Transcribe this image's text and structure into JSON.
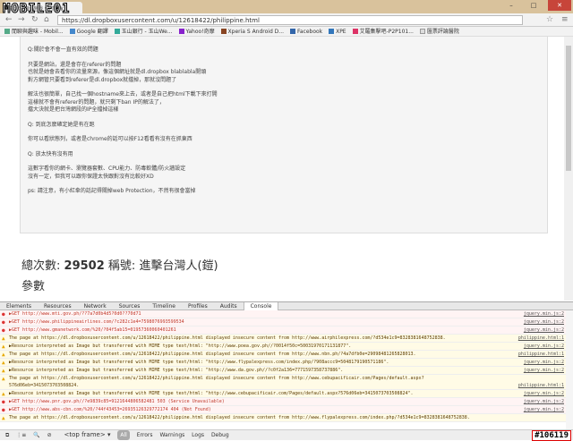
{
  "browser": {
    "tab_title": "自然閃斷 遊戲 STTATK",
    "logo": "MOBILE01",
    "url": "https://dl.dropboxusercontent.com/u/12618422/philippine.html",
    "bookmarks": [
      "閒聊與趣味 - Mobil...",
      "Google 翻譯",
      "玉山銀行 - 玉山We...",
      "Yahoo!奇摩",
      "Xperia S Android D...",
      "Facebook",
      "XPE",
      "艾羅集擊吧-P2P101...",
      "匯票評論醫院"
    ]
  },
  "article": {
    "paragraphs": [
      [
        "Q:關於會不會一直有效的問題"
      ],
      [
        "只要是網站，還是會存在referer的問題",
        "也就是她會去看你的流量來源，像這個網址就是dl.dropbox blablabla開頭",
        "對方網管只要看到referer是dl.dropbox就擋掉，那就沒問題了"
      ],
      [
        "解法也很簡單，自己找一個hostname來上去，或者是自己把html下載下來打開",
        "這樣就不會有referer的問題，就只剩下ban IP的解法了，",
        "擋大決就是把台灣網段的IP全擋掉這樣"
      ],
      [
        "Q: 到底怎麼確定她是有在跑"
      ],
      [
        "你可以看狀態列，或者是chrome的話可以按F12看看有沒有在抓東西"
      ],
      [
        "Q: 放太快有沒有用"
      ],
      [
        "這數字看你的網卡、瀏覽器套數、CPU能力、防毒軟體/防火牆設定",
        "沒有一定，但我可以跟你保證太快跟對沒有比較好XD"
      ],
      [
        "ps: 請注意，有小紅傘的話記得關掉web Protection，不然有很會當掉"
      ]
    ]
  },
  "stats": {
    "label_count": "總次數:",
    "count": "29502",
    "label_title": "稱號:",
    "title": "進擊台灣人(鎧)"
  },
  "params_heading": "參數",
  "devtools": {
    "tabs": [
      "Elements",
      "Resources",
      "Network",
      "Sources",
      "Timeline",
      "Profiles",
      "Audits",
      "Console"
    ],
    "active": "Console",
    "logs": [
      {
        "type": "err",
        "text": "▶GET http://www.mti.gov.ph/??7a7d0b4d5?0d0??70d71",
        "src": "jquery.min.js:2"
      },
      {
        "type": "err",
        "text": "▶GET http://www.philippineairlines.com/?c282c1e4=7598076993599534",
        "src": "jquery.min.js:2"
      },
      {
        "type": "err",
        "text": "▶GET http://www.gmanetwork.com/%20/?04f5ab15=01957360060401261",
        "src": "jquery.min.js:2"
      },
      {
        "type": "warn",
        "text": "The page at https://dl.dropboxusercontent.com/u/12618422/philippine.html displayed insecure content from http://www.airphilexpress.com/?d534e1c9=8328381648752838.",
        "src": "philippine.html:1"
      },
      {
        "type": "warn",
        "text": "▶Resource interpreted as Image but transferred with MIME type text/html: \"http://www.poea.gov.ph//?0014f50c=50031970171131877\".",
        "src": "jquery.min.js:2"
      },
      {
        "type": "warn",
        "text": "The page at https://dl.dropboxusercontent.com/u/12618422/philippine.html displayed insecure content from http://www.nbn.ph/?4a7dfb0e=29098481265828013.",
        "src": "philippine.html:1"
      },
      {
        "type": "warn",
        "text": "▶Resource interpreted as Image but transferred with MIME type text/html: \"http://www.flypalexpress.com/index.php/?908accc9=5048179190571186\".",
        "src": "jquery.min.js:2"
      },
      {
        "type": "warn",
        "text": "▶Resource interpreted as Image but transferred with MIME type text/html: \"http://www.da.gov.ph//?c0f2a136=7771597358737886\".",
        "src": "jquery.min.js:2"
      },
      {
        "type": "warn",
        "text": "The page at https://dl.dropboxusercontent.com/u/12618422/philippine.html displayed insecure content from http://www.cebupacificair.com/Pages/default.aspx?576d06eb=3415073703508824.",
        "src": "philippine.html:1"
      },
      {
        "type": "warn",
        "text": "▶Resource interpreted as Image but transferred with MIME type text/html: \"http://www.cebupacificair.com/Pages/default.aspx?576d06eb=3415073703508824\".",
        "src": "jquery.min.js:2"
      },
      {
        "type": "err",
        "text": "▶GET http://www.pnr.gov.ph//?e9839c85=9121644806582481 503 (Service Unavailable)",
        "src": "jquery.min.js:2"
      },
      {
        "type": "err",
        "text": "▶GET http://www.abs-cbn.com/%20/?44f43453=26935126329772174 404 (Not Found)",
        "src": "jquery.min.js:2"
      },
      {
        "type": "warn",
        "text": "The page at https://dl.dropboxusercontent.com/u/12618422/philippine.html displayed insecure content from http://www.flypalexpress.com/index.php/?d534e1c9=8328381648752838.",
        "src": ""
      }
    ],
    "frame": "<top frame>",
    "filters": [
      "All",
      "Errors",
      "Warnings",
      "Logs",
      "Debug"
    ],
    "error_count": "#106119"
  }
}
